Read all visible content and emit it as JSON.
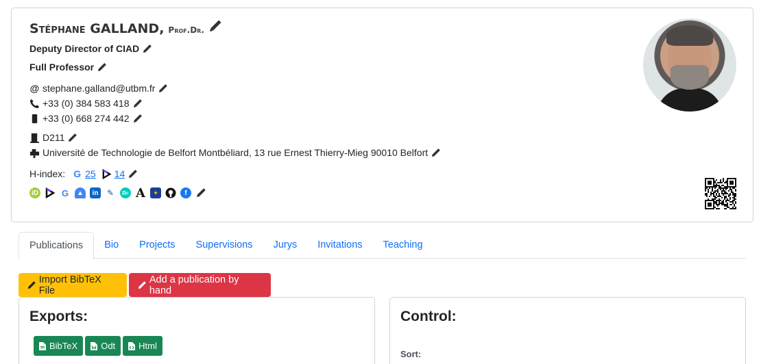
{
  "profile": {
    "name_first": "Stéphane",
    "name_last": "GALLAND",
    "name_suffix": "Prof.Dr.",
    "position": "Deputy Director of CIAD",
    "grade": "Full Professor",
    "email": "stephane.galland@utbm.fr",
    "phone": "+33 (0) 384 583 418",
    "mobile": "+33 (0) 668 274 442",
    "office": "D211",
    "address": "Université de Technologie de Belfort Montbéliard, 13 rue Ernest Thierry-Mieg 90010 Belfort",
    "hindex_label": "H-index:",
    "hindex_google": "25",
    "hindex_scopus": "14"
  },
  "tabs": [
    {
      "label": "Publications",
      "active": true
    },
    {
      "label": "Bio"
    },
    {
      "label": "Projects"
    },
    {
      "label": "Supervisions"
    },
    {
      "label": "Jurys"
    },
    {
      "label": "Invitations"
    },
    {
      "label": "Teaching"
    }
  ],
  "actions": {
    "import_label": "Import BibTeX File",
    "add_label": "Add a publication by hand"
  },
  "exports": {
    "title": "Exports:",
    "buttons": [
      "BibTeX",
      "Odt",
      "Html"
    ]
  },
  "control": {
    "title": "Control:",
    "sort_label": "Sort:"
  },
  "colors": {
    "link": "#0d6efd",
    "warning": "#ffc107",
    "danger": "#dc3545",
    "success": "#198754"
  },
  "social_icons": [
    "orcid-icon",
    "scopus-icon",
    "google-scholar-icon",
    "scholar-hat-icon",
    "linkedin-icon",
    "dblp-icon",
    "researchgate-icon",
    "academia-icon",
    "europe-icon",
    "github-icon",
    "facebook-icon"
  ]
}
